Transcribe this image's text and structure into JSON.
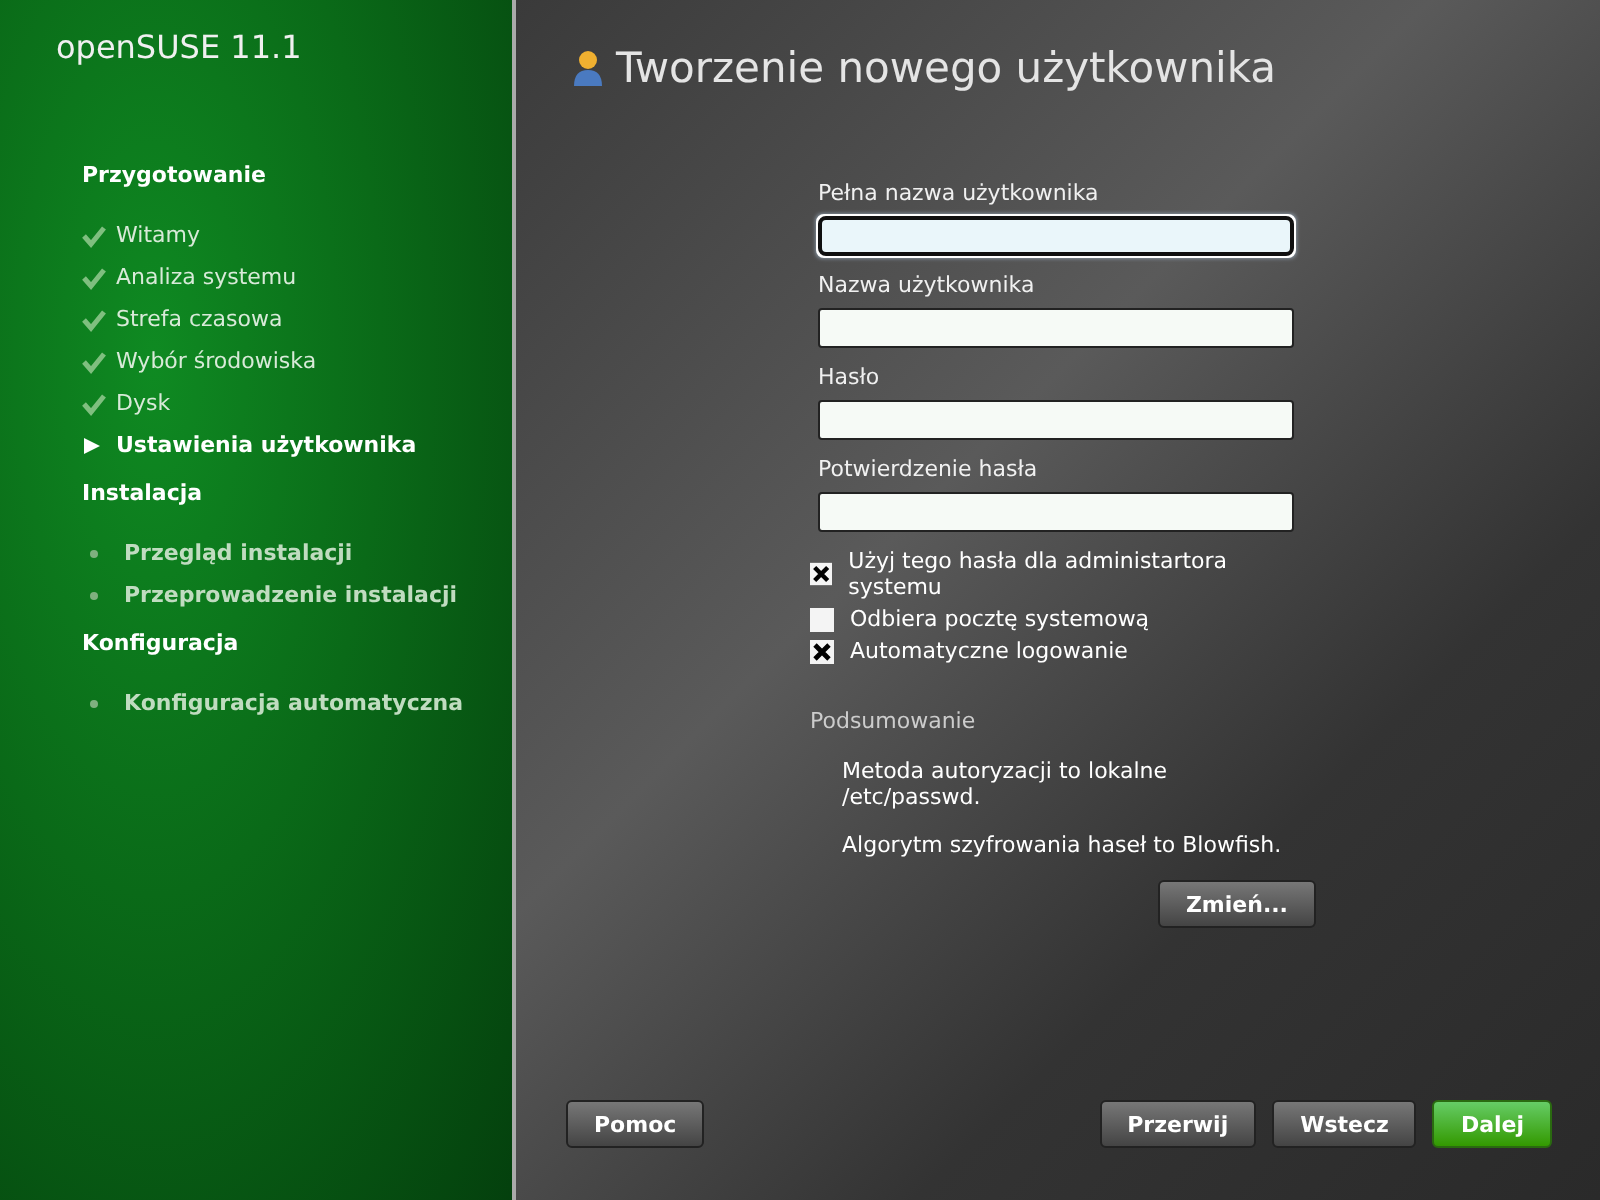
{
  "sidebar": {
    "logo": "openSUSE 11.1",
    "sections": [
      {
        "title": "Przygotowanie",
        "items": [
          {
            "label": "Witamy",
            "kind": "done"
          },
          {
            "label": "Analiza systemu",
            "kind": "done"
          },
          {
            "label": "Strefa czasowa",
            "kind": "done"
          },
          {
            "label": "Wybór środowiska",
            "kind": "done"
          },
          {
            "label": "Dysk",
            "kind": "done"
          },
          {
            "label": "Ustawienia użytkownika",
            "kind": "current"
          }
        ]
      },
      {
        "title": "Instalacja",
        "items": [
          {
            "label": "Przegląd instalacji",
            "kind": "pending"
          },
          {
            "label": "Przeprowadzenie instalacji",
            "kind": "pending"
          }
        ]
      },
      {
        "title": "Konfiguracja",
        "items": [
          {
            "label": "Konfiguracja automatyczna",
            "kind": "pending"
          }
        ]
      }
    ]
  },
  "page_title": "Tworzenie nowego użytkownika",
  "fields": [
    {
      "label": "Pełna nazwa użytkownika",
      "focused": true
    },
    {
      "label": "Nazwa użytkownika",
      "focused": false
    },
    {
      "label": "Hasło",
      "focused": false
    },
    {
      "label": "Potwierdzenie hasła",
      "focused": false
    }
  ],
  "checkboxes": [
    {
      "label": "Użyj tego hasła dla administartora systemu",
      "checked": true
    },
    {
      "label": "Odbiera pocztę systemową",
      "checked": false
    },
    {
      "label": "Automatyczne logowanie",
      "checked": true
    }
  ],
  "summary": {
    "title": "Podsumowanie",
    "lines": [
      "Metoda autoryzacji to lokalne /etc/passwd.",
      "Algorytm szyfrowania haseł to Blowfish."
    ],
    "button": "Zmień..."
  },
  "buttons": [
    {
      "label": "Pomoc",
      "kind": "help"
    },
    {
      "label": "Przerwij",
      "kind": "normal"
    },
    {
      "label": "Wstecz",
      "kind": "normal"
    },
    {
      "label": "Dalej",
      "kind": "primary"
    }
  ]
}
